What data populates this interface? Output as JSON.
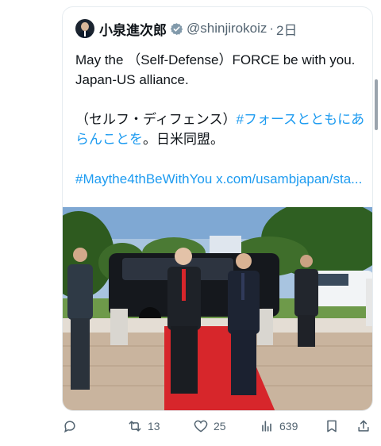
{
  "post": {
    "author_name": "小泉進次郎",
    "author_handle": "@shinjirokoiz",
    "timestamp": "2日",
    "line1": "May the （Self-Defense）FORCE be with you. Japan-US alliance.",
    "line2_plain": "（セルフ・ディフェンス）",
    "line2_hashtag": "#フォースとともにあらんことを",
    "line2_end": "。日米同盟。",
    "hashtag": "#Maythe4thBeWithYou",
    "url_text": "x.com/usambjapan/sta..."
  },
  "actions": {
    "retweets": "13",
    "likes": "25",
    "views": "639"
  },
  "colors": {
    "link": "#1d9bf0",
    "verified_badge": "#829aab",
    "carpet": "#d7262b"
  }
}
